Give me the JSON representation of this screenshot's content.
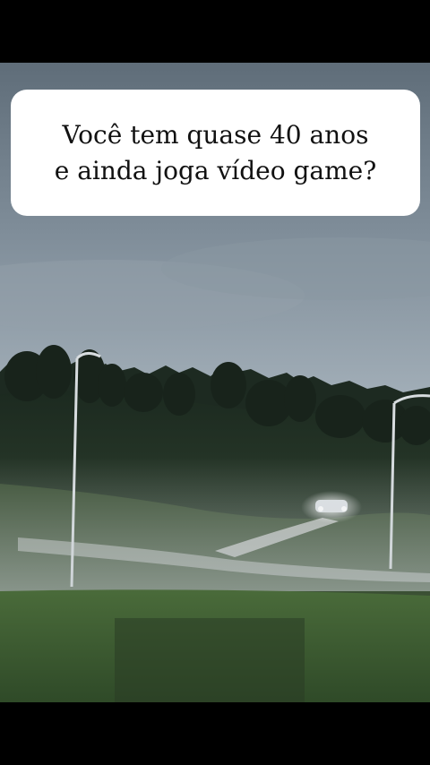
{
  "caption": {
    "line1": "Você tem quase 40 anos",
    "line2": "e ainda joga vídeo game?"
  },
  "colors": {
    "background": "#000000",
    "caption_card": "#ffffff",
    "caption_text": "#111111",
    "sky": "#7d8b97",
    "grass": "#3c5a32"
  }
}
